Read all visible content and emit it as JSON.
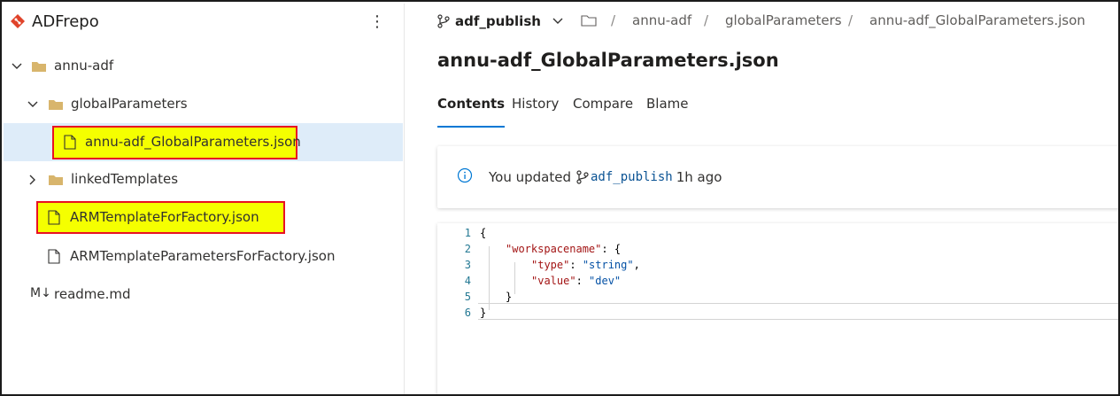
{
  "repo": {
    "name": "ADFrepo",
    "menu_glyph": "⋮"
  },
  "tree": [
    {
      "label": "annu-adf",
      "kind": "folder",
      "expanded": true
    },
    {
      "label": "globalParameters",
      "kind": "folder",
      "expanded": true
    },
    {
      "label": "annu-adf_GlobalParameters.json",
      "kind": "file",
      "selected": true
    },
    {
      "label": "linkedTemplates",
      "kind": "folder",
      "expanded": false
    },
    {
      "label": "ARMTemplateForFactory.json",
      "kind": "file"
    },
    {
      "label": "ARMTemplateParametersForFactory.json",
      "kind": "file"
    },
    {
      "label": "readme.md",
      "kind": "markdown",
      "prefix": "M↓"
    }
  ],
  "branch": {
    "name": "adf_publish"
  },
  "breadcrumb": [
    "annu-adf",
    "globalParameters",
    "annu-adf_GlobalParameters.json"
  ],
  "breadcrumb_sep": "/",
  "file_title": "annu-adf_GlobalParameters.json",
  "tabs": [
    "Contents",
    "History",
    "Compare",
    "Blame"
  ],
  "commit": {
    "prefix": "You updated",
    "branch": "adf_publish",
    "time": "1h ago"
  },
  "code": {
    "line_numbers": [
      "1",
      "2",
      "3",
      "4",
      "5",
      "6"
    ],
    "l1": "{",
    "l2_key": "\"workspacename\"",
    "l2_rest": ": {",
    "l3_key": "\"type\"",
    "l3_mid": ": ",
    "l3_val": "\"string\"",
    "l3_end": ",",
    "l4_key": "\"value\"",
    "l4_mid": ": ",
    "l4_val": "\"dev\"",
    "l5": "}",
    "l6": "}"
  },
  "colors": {
    "selected_row": "#deecf9",
    "highlight_fill": "#f5ff00",
    "highlight_border": "#e81123",
    "accent": "#0078d4",
    "repo_icon": "#e0432a",
    "folder": "#d8b56c"
  }
}
